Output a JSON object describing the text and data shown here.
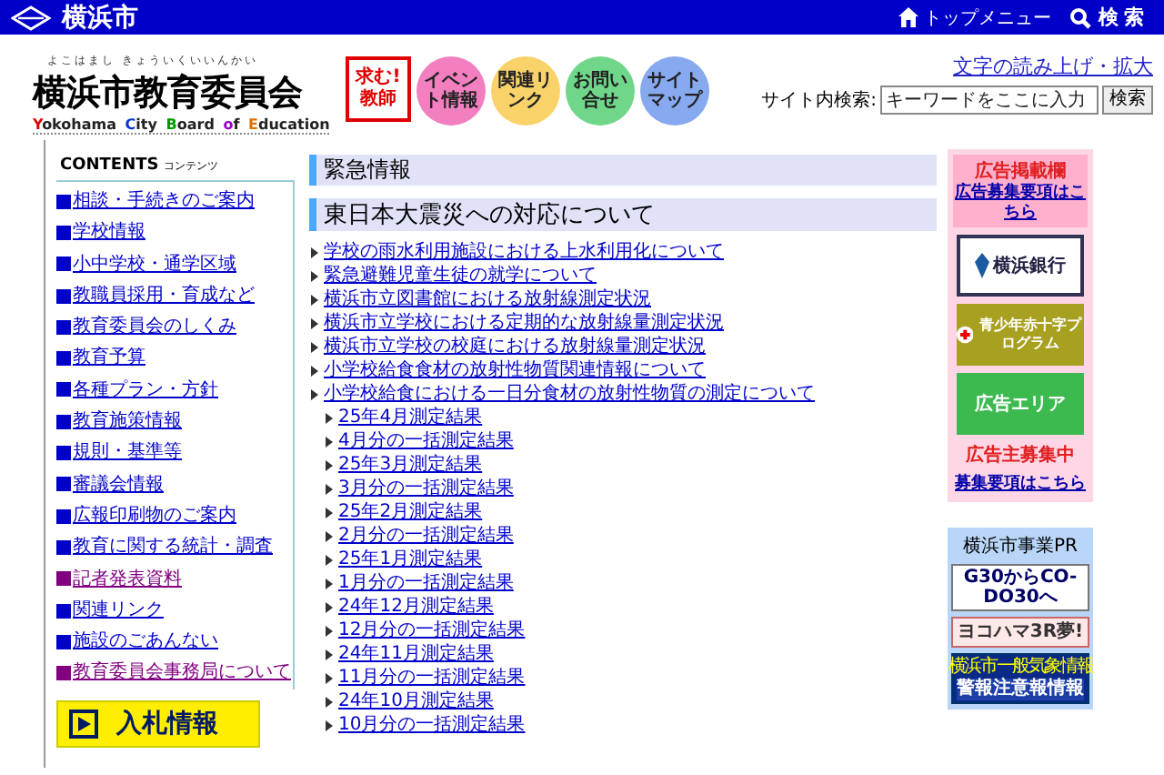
{
  "header": {
    "city": "横浜市",
    "top_menu": "トップメニュー",
    "search": "検索"
  },
  "logo": {
    "reading": "よこはまし きょういくいいんかい",
    "title": "横浜市教育委員会",
    "subtitle_words": [
      {
        "text": "Yokohama",
        "color": "#e00000"
      },
      {
        "text": "City",
        "color": "#0033cc"
      },
      {
        "text": "Board",
        "color": "#009900"
      },
      {
        "text": "of",
        "color": "#9900cc"
      },
      {
        "text": "Education",
        "color": "#e07000"
      }
    ]
  },
  "quick_links": [
    {
      "kind": "square",
      "label": "求む!教師",
      "color": "#e00000"
    },
    {
      "kind": "circle",
      "label": "イベント情報",
      "color": "#f27fbf"
    },
    {
      "kind": "circle",
      "label": "関連リンク",
      "color": "#f9d36a"
    },
    {
      "kind": "circle",
      "label": "お問い合せ",
      "color": "#6fd68a"
    },
    {
      "kind": "circle",
      "label": "サイトマップ",
      "color": "#86a9ef"
    }
  ],
  "read_aloud": "文字の読み上げ・拡大",
  "site_search": {
    "label": "サイト内検索:",
    "placeholder": "キーワードをここに入力",
    "button": "検索"
  },
  "sidebar": {
    "title": "CONTENTS",
    "title_kana": "コンテンツ",
    "items": [
      {
        "label": "相談・手続きのご案内",
        "visited": false
      },
      {
        "label": "学校情報",
        "visited": false
      },
      {
        "label": "小中学校・通学区域",
        "visited": false
      },
      {
        "label": "教職員採用・育成など",
        "visited": false
      },
      {
        "label": "教育委員会のしくみ",
        "visited": false
      },
      {
        "label": "教育予算",
        "visited": false
      },
      {
        "label": "各種プラン・方針",
        "visited": false
      },
      {
        "label": "教育施策情報",
        "visited": false
      },
      {
        "label": "規則・基準等",
        "visited": false
      },
      {
        "label": "審議会情報",
        "visited": false
      },
      {
        "label": "広報印刷物のご案内",
        "visited": false
      },
      {
        "label": "教育に関する統計・調査",
        "visited": false
      },
      {
        "label": "記者発表資料",
        "visited": true
      },
      {
        "label": "関連リンク",
        "visited": false
      },
      {
        "label": "施設のごあんない",
        "visited": false
      },
      {
        "label": "教育委員会事務局について",
        "visited": true
      }
    ],
    "bid_banner": "入札情報"
  },
  "sections": [
    {
      "title": "緊急情報"
    },
    {
      "title": "東日本大震災への対応について",
      "links": [
        {
          "label": "学校の雨水利用施設における上水利用化について"
        },
        {
          "label": "緊急避難児童生徒の就学について"
        },
        {
          "label": "横浜市立図書館における放射線測定状況"
        },
        {
          "label": "横浜市立学校における定期的な放射線量測定状況"
        },
        {
          "label": "横浜市立学校の校庭における放射線量測定状況"
        },
        {
          "label": "小学校給食食材の放射性物質関連情報について"
        },
        {
          "label": "小学校給食における一日分食材の放射性物質の測定について",
          "children": [
            {
              "label": "25年4月測定結果"
            },
            {
              "label": "4月分の一括測定結果"
            },
            {
              "label": "25年3月測定結果"
            },
            {
              "label": "3月分の一括測定結果"
            },
            {
              "label": "25年2月測定結果"
            },
            {
              "label": "2月分の一括測定結果"
            },
            {
              "label": "25年1月測定結果"
            },
            {
              "label": "1月分の一括測定結果"
            },
            {
              "label": "24年12月測定結果"
            },
            {
              "label": "12月分の一括測定結果"
            },
            {
              "label": "24年11月測定結果"
            },
            {
              "label": "11月分の一括測定結果"
            },
            {
              "label": "24年10月測定結果"
            },
            {
              "label": "10月分の一括測定結果"
            }
          ]
        }
      ]
    }
  ],
  "ads": {
    "title": "広告掲載欄",
    "guide_link": "広告募集要項はこちら",
    "banners": [
      {
        "kind": "bank",
        "label": "横浜銀行"
      },
      {
        "kind": "redcross",
        "label": "青少年赤十字プログラム"
      },
      {
        "kind": "plain",
        "label": "広告エリア"
      }
    ],
    "wanted": "広告主募集中",
    "wanted_link": "募集要項はこちら"
  },
  "pr": {
    "title": "横浜市事業PR",
    "banners": [
      {
        "kind": "codo",
        "label": "G30からCO-DO30へ"
      },
      {
        "kind": "recycle",
        "label": "ヨコハマ3R夢!"
      },
      {
        "kind": "weather",
        "top": "横浜市一般気象情報",
        "label": "警報注意報情報"
      }
    ]
  }
}
